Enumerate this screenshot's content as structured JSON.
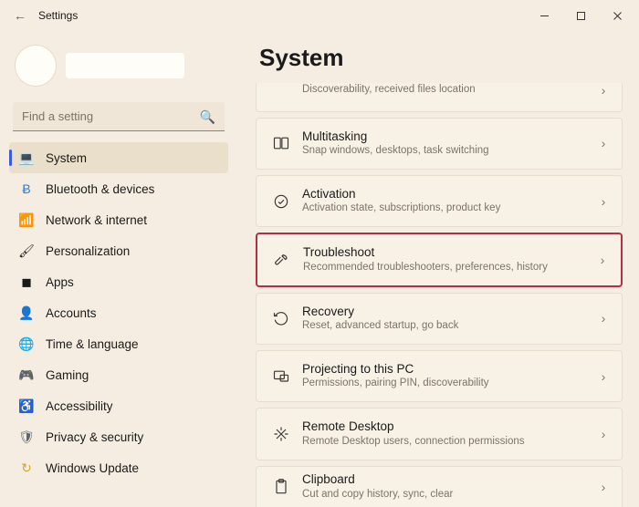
{
  "app_title": "Settings",
  "search_placeholder": "Find a setting",
  "page_heading": "System",
  "nav": [
    {
      "label": "System"
    },
    {
      "label": "Bluetooth & devices"
    },
    {
      "label": "Network & internet"
    },
    {
      "label": "Personalization"
    },
    {
      "label": "Apps"
    },
    {
      "label": "Accounts"
    },
    {
      "label": "Time & language"
    },
    {
      "label": "Gaming"
    },
    {
      "label": "Accessibility"
    },
    {
      "label": "Privacy & security"
    },
    {
      "label": "Windows Update"
    }
  ],
  "rows": [
    {
      "title": "",
      "sub": "Discoverability, received files location"
    },
    {
      "title": "Multitasking",
      "sub": "Snap windows, desktops, task switching"
    },
    {
      "title": "Activation",
      "sub": "Activation state, subscriptions, product key"
    },
    {
      "title": "Troubleshoot",
      "sub": "Recommended troubleshooters, preferences, history"
    },
    {
      "title": "Recovery",
      "sub": "Reset, advanced startup, go back"
    },
    {
      "title": "Projecting to this PC",
      "sub": "Permissions, pairing PIN, discoverability"
    },
    {
      "title": "Remote Desktop",
      "sub": "Remote Desktop users, connection permissions"
    },
    {
      "title": "Clipboard",
      "sub": "Cut and copy history, sync, clear"
    }
  ]
}
